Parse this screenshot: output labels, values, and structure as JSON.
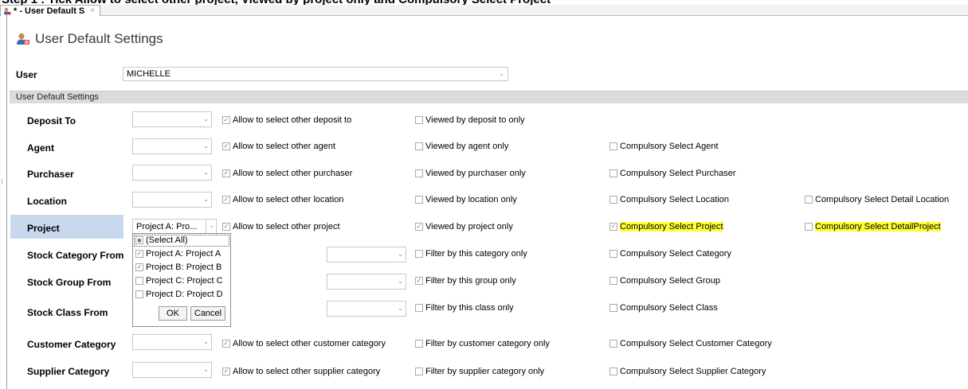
{
  "doc": {
    "top_text": "Step 1 : Tick Allow to select other project, Viewed by project only and Compulsory Select Project"
  },
  "tab": {
    "label": "* - User Default S",
    "close": "×"
  },
  "header": {
    "title": "User Default Settings",
    "icon": "user-settings-icon"
  },
  "user": {
    "label": "User",
    "value": "MICHELLE"
  },
  "group": {
    "title": "User Default Settings"
  },
  "rows": {
    "deposit": {
      "label": "Deposit To",
      "c1": "Allow to select other deposit to",
      "c2": "Viewed by deposit to only"
    },
    "agent": {
      "label": "Agent",
      "c1": "Allow to select other agent",
      "c2": "Viewed by agent only",
      "c3": "Compulsory Select Agent"
    },
    "purchaser": {
      "label": "Purchaser",
      "c1": "Allow to select other purchaser",
      "c2": "Viewed by purchaser only",
      "c3": "Compulsory Select Purchaser"
    },
    "location": {
      "label": "Location",
      "c1": "Allow to select other location",
      "c2": "Viewed by location only",
      "c3": "Compulsory Select Location",
      "c4": "Compulsory Select Detail Location"
    },
    "project": {
      "label": "Project",
      "value": "Project A: Pro...",
      "c1": "Allow to select other project",
      "c2": "Viewed by project only",
      "c3": "Compulsory Select Project",
      "c4a": "Compulsory Select Detail ",
      "c4b": "Project"
    },
    "stockcat": {
      "label": "Stock Category From",
      "c2": "Filter by this category only",
      "c3": "Compulsory Select Category"
    },
    "stockgrp": {
      "label": "Stock Group From",
      "c2": "Filter by this group only",
      "c3": "Compulsory Select Group"
    },
    "stockcls": {
      "label": "Stock Class From",
      "c2": "Filter by this class only",
      "c3": "Compulsory Select Class"
    },
    "custcat": {
      "label": "Customer Category",
      "c1": "Allow to select other customer category",
      "c2": "Filter by customer category only",
      "c3": "Compulsory Select Customer Category"
    },
    "suppcat": {
      "label": "Supplier Category",
      "c1": "Allow to select other supplier category",
      "c2": "Filter by supplier category only",
      "c3": "Compulsory Select Supplier Category"
    }
  },
  "dropdown": {
    "items": [
      "(Select All)",
      "Project A: Project A",
      "Project B: Project B",
      "Project C: Project C",
      "Project D: Project D"
    ],
    "ok": "OK",
    "cancel": "Cancel"
  },
  "colors": {
    "highlight": "#ffff33",
    "row_selected": "#c8d8ef",
    "group_header": "#dcdcdc"
  }
}
